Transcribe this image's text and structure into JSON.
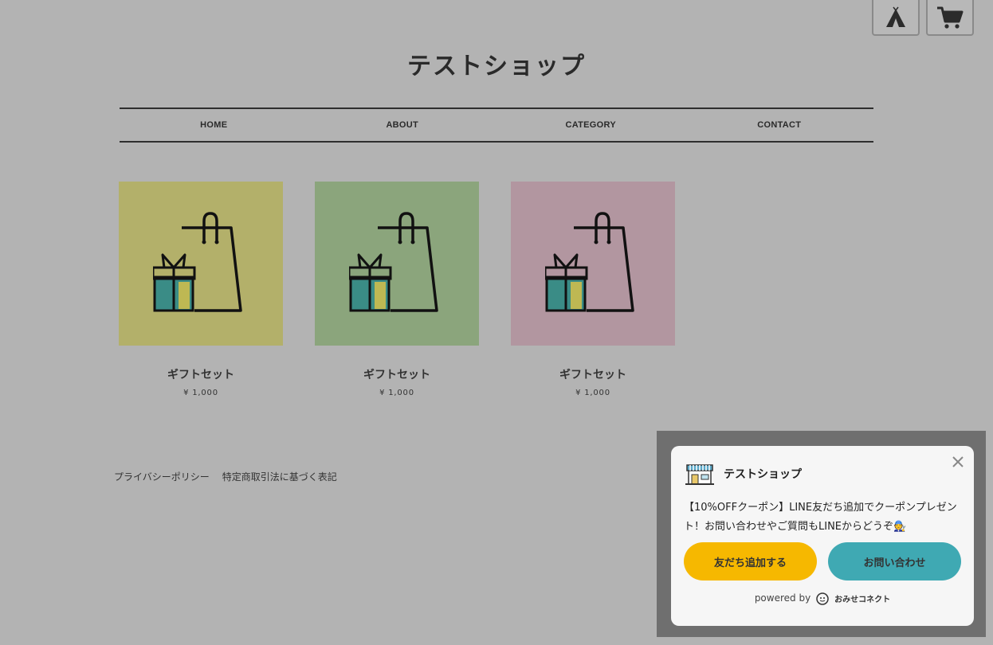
{
  "header": {
    "shop_title": "テストショップ"
  },
  "top_icons": [
    {
      "icon": "tent-icon"
    },
    {
      "icon": "cart-icon"
    }
  ],
  "nav": [
    {
      "label": "HOME"
    },
    {
      "label": "ABOUT"
    },
    {
      "label": "CATEGORY"
    },
    {
      "label": "CONTACT"
    }
  ],
  "products": [
    {
      "name": "ギフトセット",
      "price": "¥ 1,000",
      "bg": "#b3b06a"
    },
    {
      "name": "ギフトセット",
      "price": "¥ 1,000",
      "bg": "#8ba57c"
    },
    {
      "name": "ギフトセット",
      "price": "¥ 1,000",
      "bg": "#b296a0"
    }
  ],
  "footer": {
    "links": [
      "プライバシーポリシー",
      "特定商取引法に基づく表記"
    ]
  },
  "popup": {
    "shop_name": "テストショップ",
    "message": "【10%OFFクーポン】LINE友だち追加でクーポンプレゼント！お問い合わせやご質問もLINEからどうぞ🧑‍🔧",
    "add_friend_label": "友だち追加する",
    "contact_label": "お問い合わせ",
    "powered_by": "powered by",
    "brand": "おみせコネクト",
    "colors": {
      "primary": "#f6b800",
      "secondary": "#3fa9b3"
    }
  }
}
